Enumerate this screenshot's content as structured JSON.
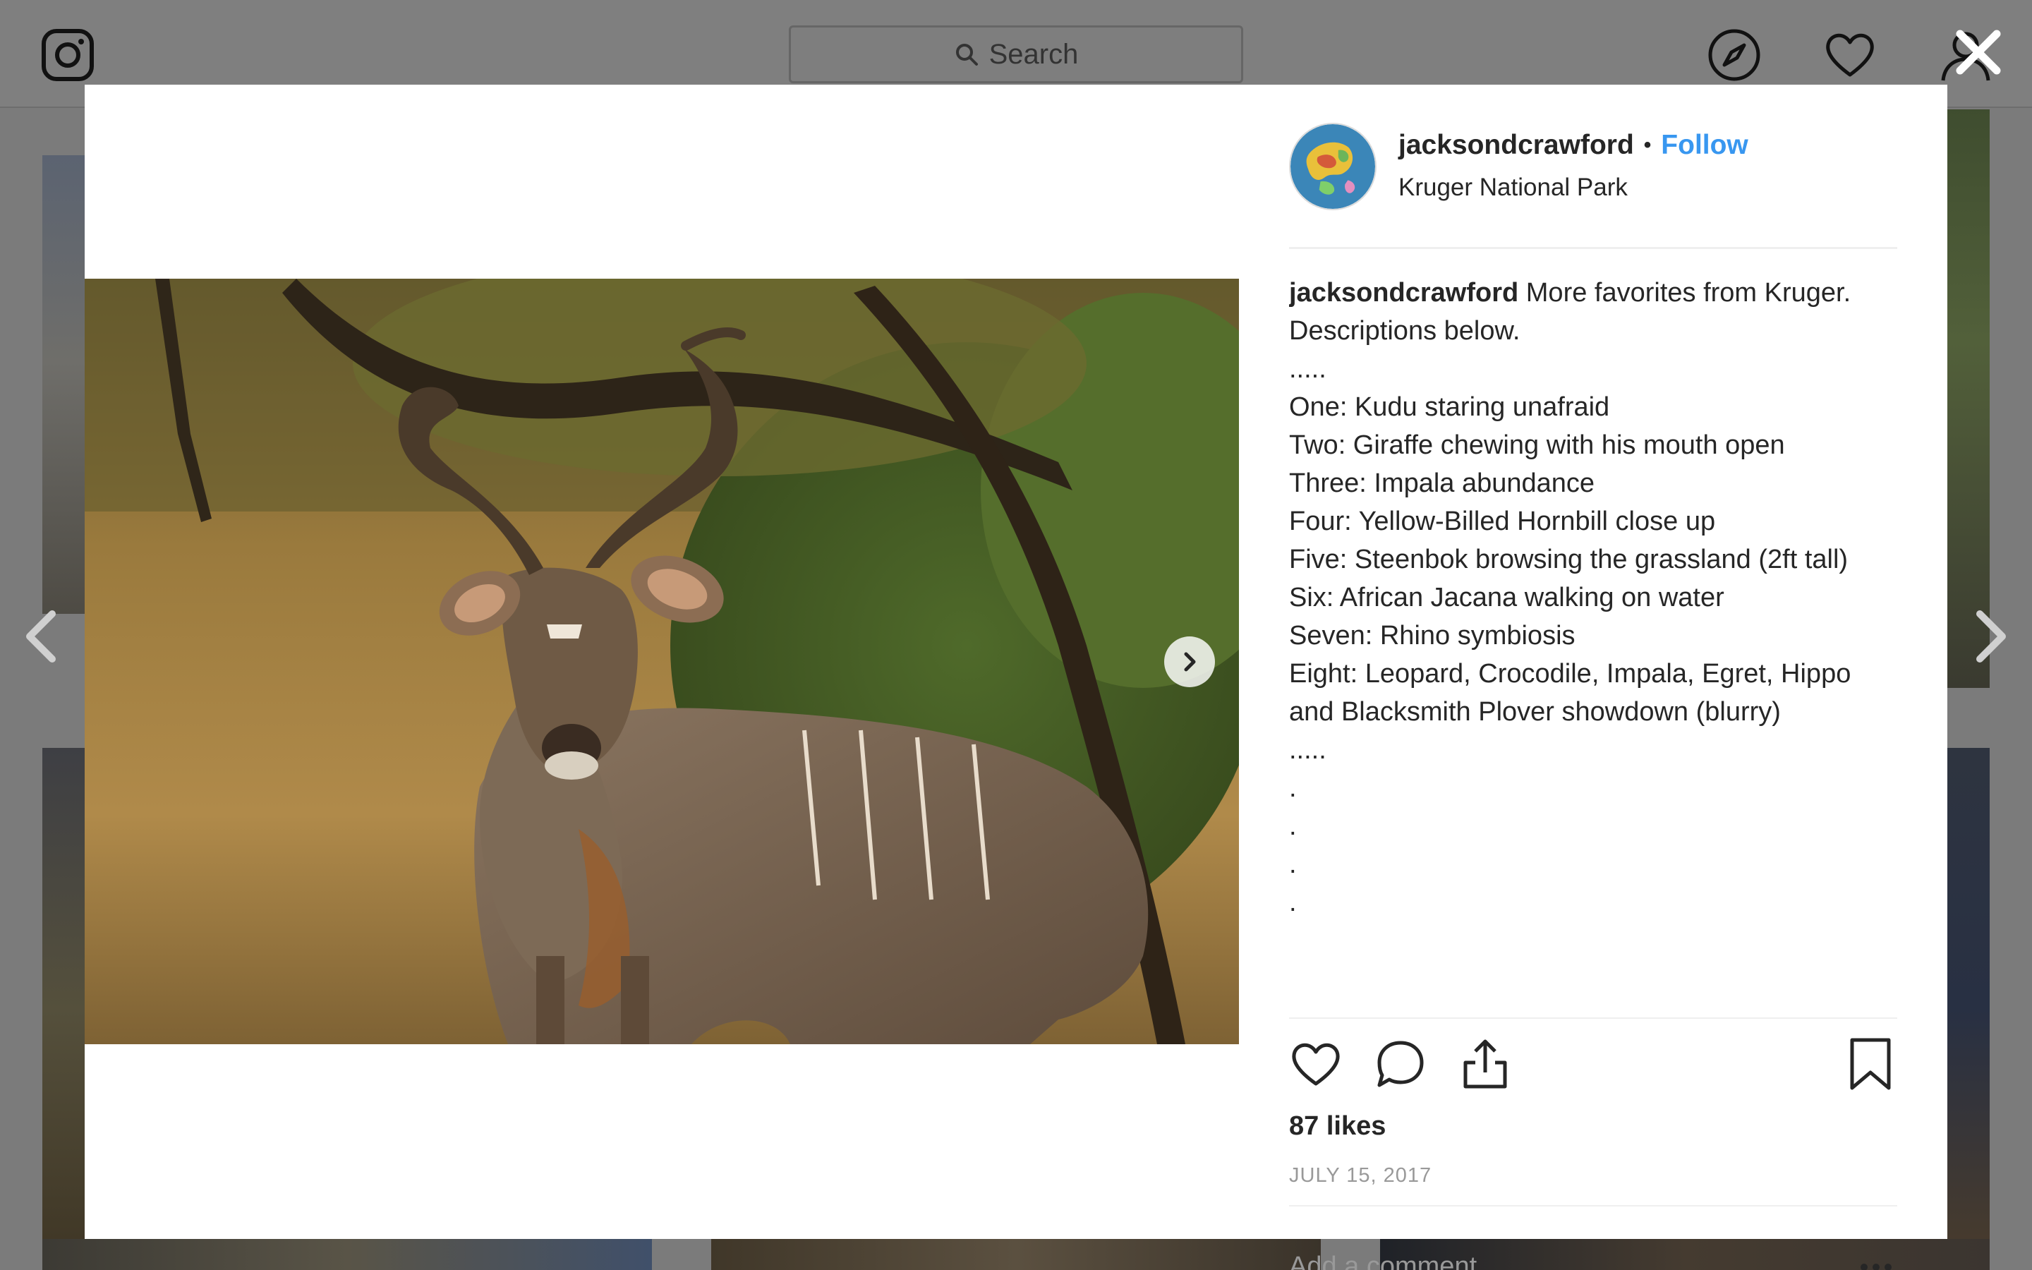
{
  "topbar": {
    "search_placeholder": "Search",
    "logo_icon": "instagram-camera-icon",
    "nav_icons": [
      "compass-icon",
      "heart-icon",
      "profile-icon"
    ]
  },
  "modal": {
    "close_icon": "close-icon",
    "post": {
      "username": "jacksondcrawford",
      "separator": "•",
      "follow_label": "Follow",
      "location": "Kruger National Park",
      "caption_user": "jacksondcrawford",
      "caption_lines": [
        "More favorites from Kruger.",
        "Descriptions below.",
        ".....",
        "One: Kudu staring unafraid",
        "Two: Giraffe chewing with his mouth open",
        "Three: Impala abundance",
        "Four: Yellow-Billed Hornbill close up",
        "Five: Steenbok browsing the grassland (2ft tall)",
        "Six: African Jacana walking on water",
        "Seven: Rhino symbiosis",
        "Eight: Leopard, Crocodile, Impala, Egret, Hippo",
        "and Blacksmith Plover showdown (blurry)",
        ".....",
        ".",
        ".",
        ".",
        "."
      ],
      "likes": "87 likes",
      "date": "JULY 15, 2017",
      "comment_placeholder": "Add a comment...",
      "colors": {
        "link": "#3897f0",
        "text": "#262626",
        "muted": "#999999"
      }
    }
  }
}
